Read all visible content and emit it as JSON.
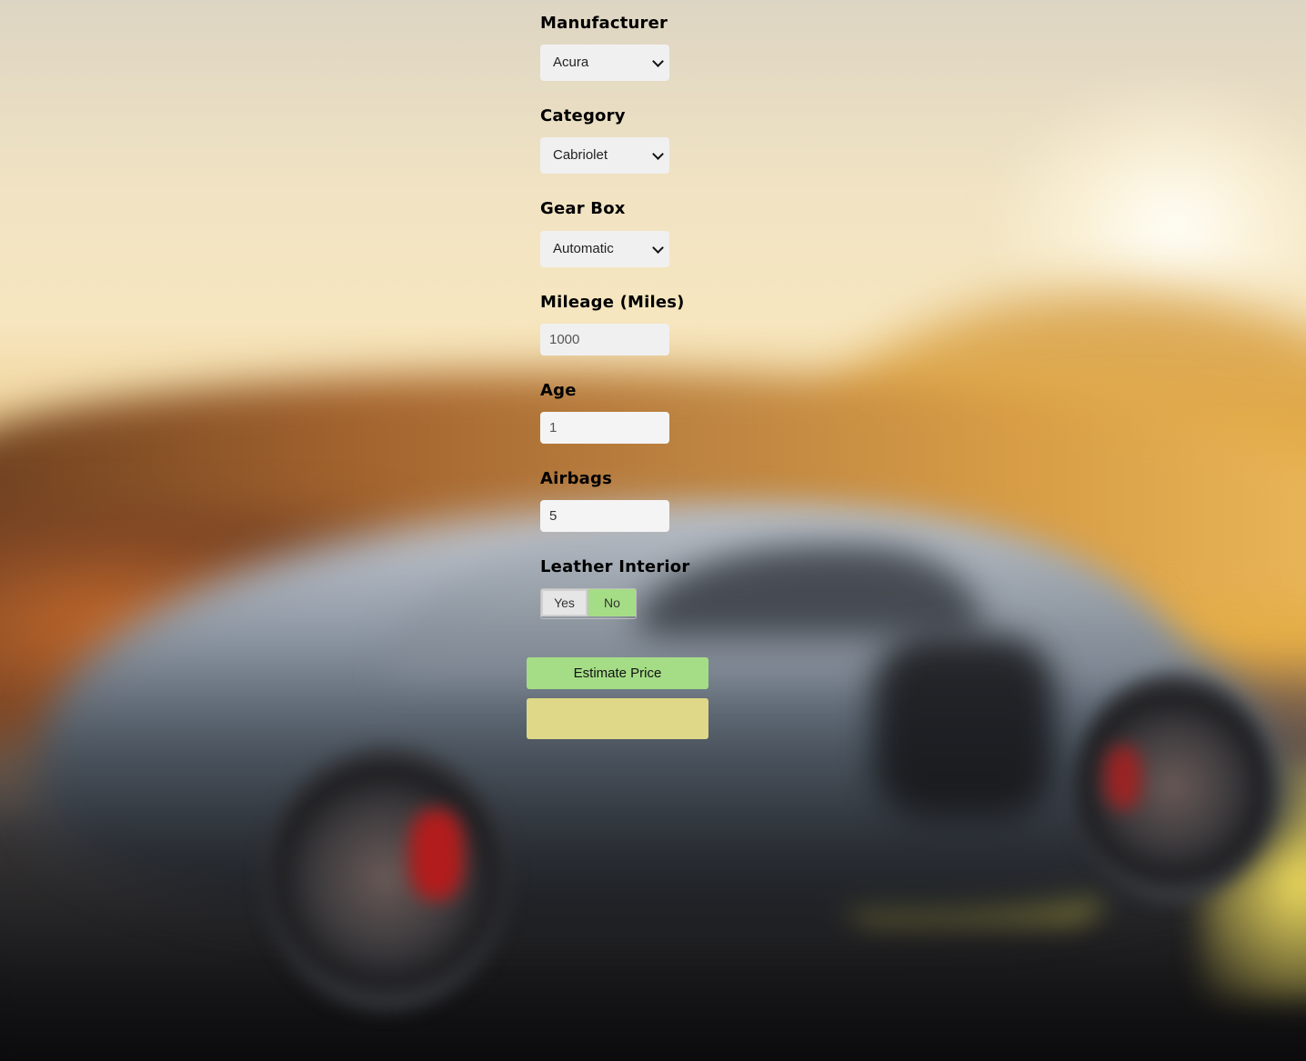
{
  "form": {
    "manufacturer": {
      "label": "Manufacturer",
      "value": "Acura"
    },
    "category": {
      "label": "Category",
      "value": "Cabriolet"
    },
    "gear_box": {
      "label": "Gear Box",
      "value": "Automatic"
    },
    "mileage": {
      "label": "Mileage (Miles)",
      "value": "1000"
    },
    "age": {
      "label": "Age",
      "value": "1"
    },
    "airbags": {
      "label": "Airbags",
      "value": "5"
    },
    "leather_interior": {
      "label": "Leather Interior",
      "options": [
        "Yes",
        "No"
      ],
      "selected": "No"
    },
    "estimate_button_label": "Estimate Price",
    "result_text": ""
  },
  "colors": {
    "accent_green": "#a5dd86",
    "result_yellow": "#ded888",
    "field_bg": "#f0f0f0"
  }
}
